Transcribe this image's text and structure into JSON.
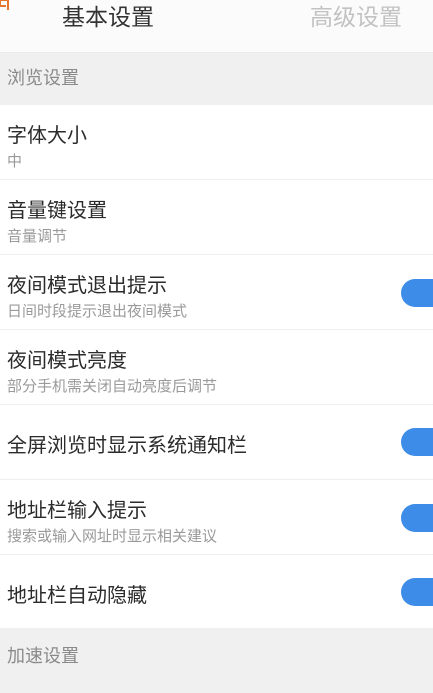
{
  "tabs": {
    "basic": "基本设置",
    "advanced": "高级设置"
  },
  "sections": {
    "browse": "浏览设置",
    "speed": "加速设置"
  },
  "rows": {
    "font_size": {
      "title": "字体大小",
      "subtitle": "中"
    },
    "volume_key": {
      "title": "音量键设置",
      "subtitle": "音量调节"
    },
    "night_exit": {
      "title": "夜间模式退出提示",
      "subtitle": "日间时段提示退出夜间模式",
      "toggle_on": true
    },
    "night_brightness": {
      "title": "夜间模式亮度",
      "subtitle": "部分手机需关闭自动亮度后调节"
    },
    "fullscreen_notify": {
      "title": "全屏浏览时显示系统通知栏",
      "toggle_on": true
    },
    "address_hint": {
      "title": "地址栏输入提示",
      "subtitle": "搜索或输入网址时显示相关建议",
      "toggle_on": true
    },
    "address_autohide": {
      "title": "地址栏自动隐藏",
      "toggle_on": true
    }
  },
  "colors": {
    "toggle_on": "#3d8de8",
    "back_icon_accent": "#e8732a"
  },
  "icons": {
    "back": "back-arrow-icon"
  }
}
